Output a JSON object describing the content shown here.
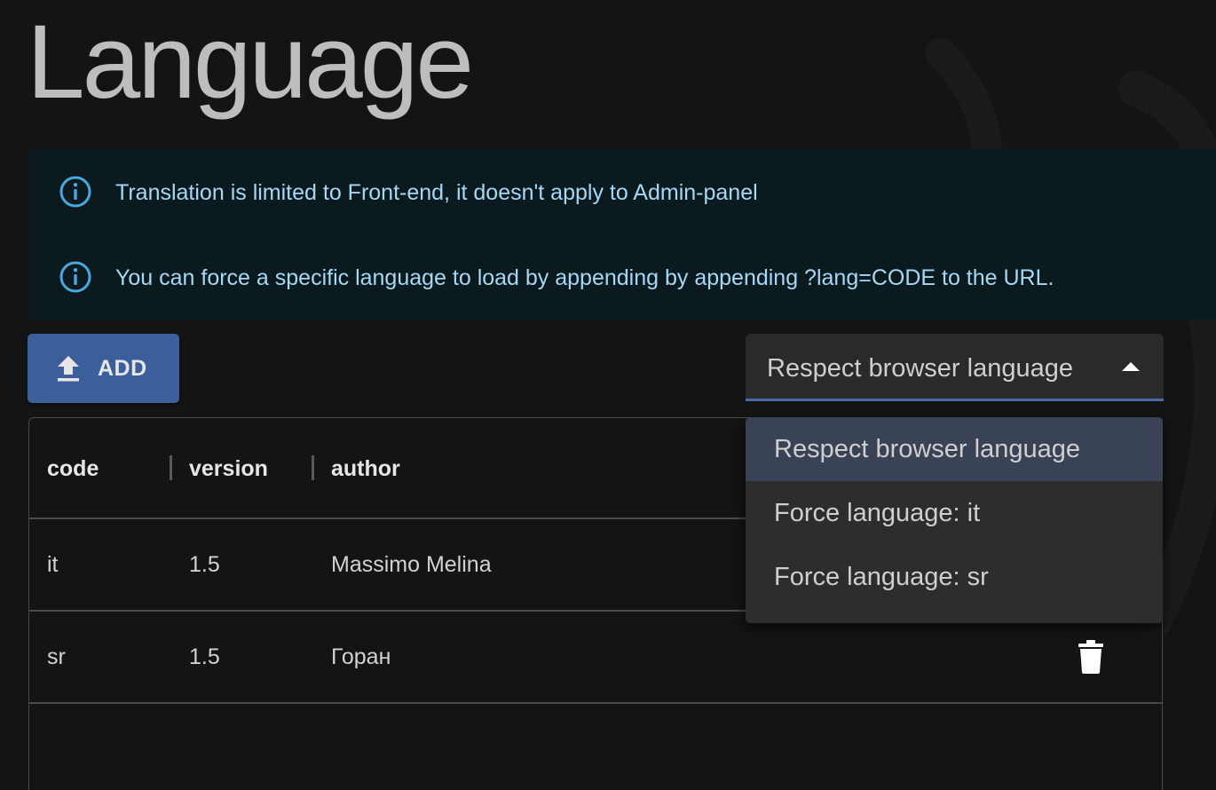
{
  "page": {
    "title": "Language"
  },
  "info": {
    "messages": [
      "Translation is limited to Front-end, it doesn't apply to Admin-panel",
      "You can force a specific language to load by appending by appending ?lang=CODE to the URL."
    ],
    "icon": "info-icon",
    "text_color": "#a6d8f5",
    "bg_color": "#0b1a1e"
  },
  "toolbar": {
    "add_label": "ADD",
    "add_icon": "upload-icon",
    "add_color": "#3c5e9a"
  },
  "language_select": {
    "value": "Respect browser language",
    "expanded": true,
    "options": [
      {
        "label": "Respect browser language",
        "selected": true
      },
      {
        "label": "Force language: it",
        "selected": false
      },
      {
        "label": "Force language: sr",
        "selected": false
      }
    ]
  },
  "table": {
    "columns": [
      "code",
      "version",
      "author"
    ],
    "rows": [
      {
        "code": "it",
        "version": "1.5",
        "author": "Massimo Melina"
      },
      {
        "code": "sr",
        "version": "1.5",
        "author": "Горан"
      }
    ],
    "row_action_icon": "trash-icon"
  }
}
